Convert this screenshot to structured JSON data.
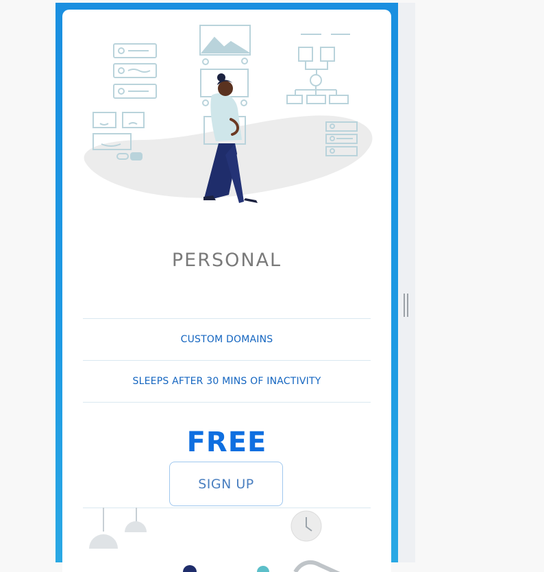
{
  "plan": {
    "name": "PERSONAL",
    "features": [
      "CUSTOM DOMAINS",
      "SLEEPS AFTER 30 MINS OF INACTIVITY"
    ],
    "price": "FREE",
    "cta_label": "SIGN UP"
  },
  "colors": {
    "frame_blue": "#1a8fe0",
    "feature_text": "#1465c0",
    "price_blue": "#0f6fe0",
    "plan_name_gray": "#7a7a7a"
  },
  "icons": [
    "person-walking-illustration",
    "sketch-wall-illustration",
    "pendant-lamp-icon",
    "wall-clock-icon"
  ]
}
